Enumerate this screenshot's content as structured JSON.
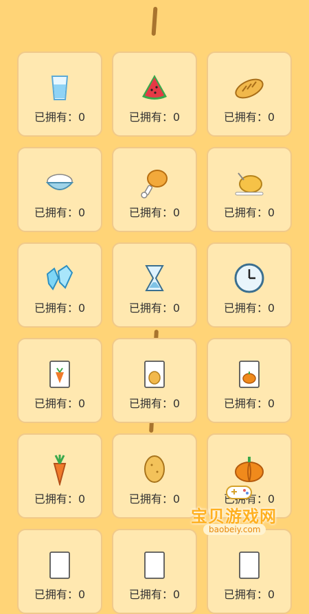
{
  "owned_label": "已拥有：",
  "items": [
    {
      "icon": "water-glass",
      "count": 0
    },
    {
      "icon": "watermelon",
      "count": 0
    },
    {
      "icon": "bread",
      "count": 0
    },
    {
      "icon": "rice-bowl",
      "count": 0
    },
    {
      "icon": "chicken-leg",
      "count": 0
    },
    {
      "icon": "roast-chicken",
      "count": 0
    },
    {
      "icon": "ice-crystal",
      "count": 0
    },
    {
      "icon": "hourglass",
      "count": 0
    },
    {
      "icon": "clock",
      "count": 0
    },
    {
      "icon": "carrot-seed-packet",
      "count": 0
    },
    {
      "icon": "potato-seed-packet",
      "count": 0
    },
    {
      "icon": "pumpkin-seed-packet",
      "count": 0
    },
    {
      "icon": "carrot",
      "count": 0
    },
    {
      "icon": "potato",
      "count": 0
    },
    {
      "icon": "pumpkin",
      "count": 0
    },
    {
      "icon": "seed-packet",
      "count": 0
    },
    {
      "icon": "seed-packet",
      "count": 0
    },
    {
      "icon": "seed-packet",
      "count": 0
    }
  ],
  "watermark": {
    "title": "宝贝游戏网",
    "url": "baobeiy.com"
  }
}
